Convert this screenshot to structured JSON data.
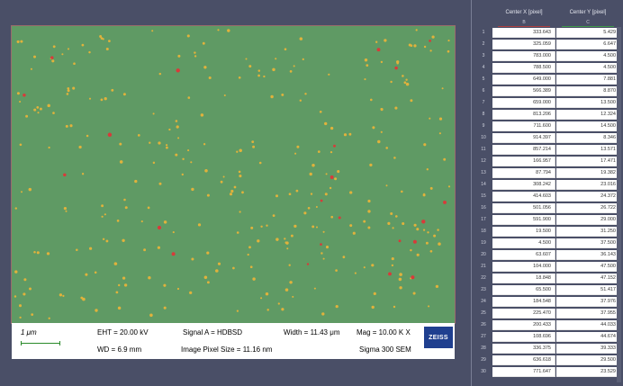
{
  "image": {
    "databar": {
      "scale_label": "1 μm",
      "eht": "EHT = 20.00 kV",
      "signal": "Signal A = HDBSD",
      "width": "Width = 11.43 μm",
      "mag": "Mag =   10.00 K X",
      "wd": "WD =  6.9 mm",
      "pixel_size": "Image Pixel Size = 11.16 nm",
      "instrument": "Sigma 300 SEM",
      "logo": "ZEISS"
    },
    "colors": {
      "background": "#5f9a64",
      "particle_yellow": "#e0b23c",
      "particle_red": "#d83a3a"
    }
  },
  "table": {
    "columns": [
      {
        "label": "Center X [pixel]",
        "letter": "B",
        "color": "#b04040"
      },
      {
        "label": "Center Y [pixel]",
        "letter": "C",
        "color": "#3f9a4a"
      }
    ],
    "rows": [
      {
        "n": "1",
        "x": "333.643",
        "y": "5.429"
      },
      {
        "n": "2",
        "x": "325.059",
        "y": "6.647"
      },
      {
        "n": "3",
        "x": "783.000",
        "y": "4.500"
      },
      {
        "n": "4",
        "x": "788.500",
        "y": "4.500"
      },
      {
        "n": "5",
        "x": "649.000",
        "y": "7.881"
      },
      {
        "n": "6",
        "x": "566.389",
        "y": "8.870"
      },
      {
        "n": "7",
        "x": "659.000",
        "y": "13.500"
      },
      {
        "n": "8",
        "x": "813.206",
        "y": "12.324"
      },
      {
        "n": "9",
        "x": "711.600",
        "y": "14.500"
      },
      {
        "n": "10",
        "x": "914.397",
        "y": "8.346"
      },
      {
        "n": "11",
        "x": "857.214",
        "y": "13.571"
      },
      {
        "n": "12",
        "x": "166.957",
        "y": "17.471"
      },
      {
        "n": "13",
        "x": "87.794",
        "y": "19.382"
      },
      {
        "n": "14",
        "x": "308.242",
        "y": "23.016"
      },
      {
        "n": "15",
        "x": "414.603",
        "y": "24.372"
      },
      {
        "n": "16",
        "x": "501.056",
        "y": "26.722"
      },
      {
        "n": "17",
        "x": "591.900",
        "y": "29.000"
      },
      {
        "n": "18",
        "x": "19.500",
        "y": "31.250"
      },
      {
        "n": "19",
        "x": "4.500",
        "y": "37.500"
      },
      {
        "n": "20",
        "x": "63.607",
        "y": "36.143"
      },
      {
        "n": "21",
        "x": "104.000",
        "y": "47.500"
      },
      {
        "n": "22",
        "x": "18.848",
        "y": "47.152"
      },
      {
        "n": "23",
        "x": "65.500",
        "y": "51.417"
      },
      {
        "n": "24",
        "x": "184.548",
        "y": "37.976"
      },
      {
        "n": "25",
        "x": "225.470",
        "y": "37.955"
      },
      {
        "n": "26",
        "x": "200.433",
        "y": "44.033"
      },
      {
        "n": "27",
        "x": "108.696",
        "y": "44.674"
      },
      {
        "n": "28",
        "x": "336.375",
        "y": "39.333"
      },
      {
        "n": "29",
        "x": "636.618",
        "y": "29.500"
      },
      {
        "n": "30",
        "x": "771.647",
        "y": "23.529"
      }
    ]
  }
}
